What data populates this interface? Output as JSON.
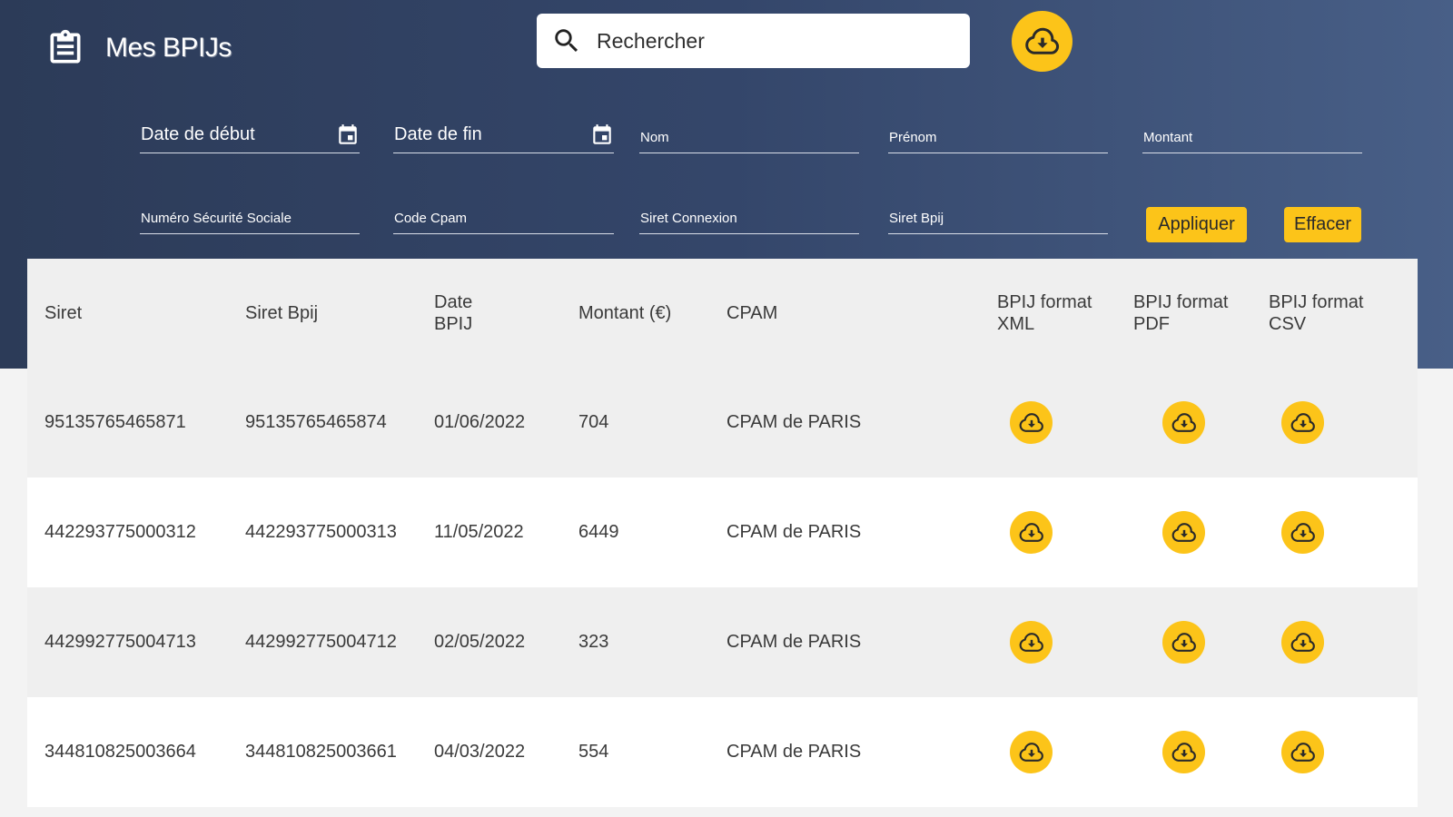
{
  "app": {
    "title": "Mes BPIJs",
    "brand_icon": "clipboard-list-icon"
  },
  "search": {
    "placeholder": "Rechercher",
    "icon": "search-icon"
  },
  "top_download": {
    "icon": "cloud-download-icon"
  },
  "filters": {
    "start_date": "Date de début",
    "end_date": "Date de fin",
    "nom": "Nom",
    "prenom": "Prénom",
    "montant": "Montant",
    "nss": "Numéro Sécurité Sociale",
    "code_cpam": "Code Cpam",
    "siret_connexion": "Siret Connexion",
    "siret_bpij": "Siret Bpij",
    "calendar_icon": "calendar-icon"
  },
  "actions": {
    "apply": "Appliquer",
    "clear": "Effacer"
  },
  "table": {
    "headers": {
      "siret": "Siret",
      "siret_bpij": "Siret Bpij",
      "date": "Date BPIJ",
      "montant": "Montant (€)",
      "cpam": "CPAM",
      "xml": "BPIJ format XML",
      "pdf": "BPIJ format PDF",
      "csv": "BPIJ format CSV"
    },
    "rows": [
      {
        "siret": "95135765465871",
        "siret_bpij": "95135765465874",
        "date": "01/06/2022",
        "montant": "704",
        "cpam": "CPAM de PARIS"
      },
      {
        "siret": "442293775000312",
        "siret_bpij": "442293775000313",
        "date": "11/05/2022",
        "montant": "6449",
        "cpam": "CPAM de PARIS"
      },
      {
        "siret": "442992775004713",
        "siret_bpij": "442992775004712",
        "date": "02/05/2022",
        "montant": "323",
        "cpam": "CPAM de PARIS"
      },
      {
        "siret": "344810825003664",
        "siret_bpij": "344810825003661",
        "date": "04/03/2022",
        "montant": "554",
        "cpam": "CPAM de PARIS"
      }
    ]
  },
  "colors": {
    "accent": "#fcc419",
    "header_dark": "#2c3b58",
    "header_light": "#485f87",
    "row_shade": "#efefef"
  }
}
